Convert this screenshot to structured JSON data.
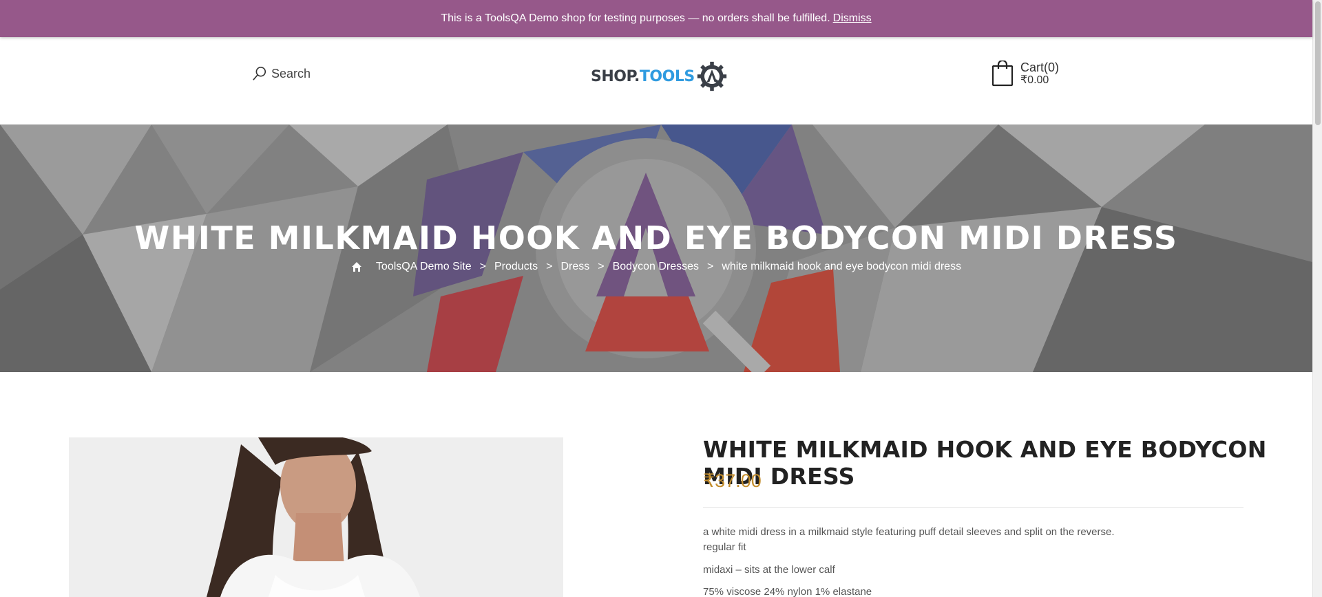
{
  "banner": {
    "message": "This is a ToolsQA Demo shop for testing purposes — no orders shall be fulfilled.",
    "dismiss_label": "Dismiss"
  },
  "header": {
    "search_label": "Search",
    "logo": {
      "shop": "SHOP",
      "dot": ".",
      "tools": "TOOLS"
    },
    "cart_label": "Cart(0)",
    "cart_amount": "₹0.00"
  },
  "hero": {
    "title": "WHITE MILKMAID HOOK AND EYE BODYCON MIDI DRESS",
    "breadcrumb": [
      "ToolsQA Demo Site",
      "Products",
      "Dress",
      "Bodycon Dresses",
      "white milkmaid hook and eye bodycon midi dress"
    ],
    "separator": ">"
  },
  "product": {
    "title": "WHITE MILKMAID HOOK AND EYE BODYCON MIDI DRESS",
    "price": "₹37.00",
    "description_lines": [
      "a white midi dress in a milkmaid style featuring puff detail sleeves and split on the reverse.",
      "regular fit",
      "midaxi – sits at the lower calf",
      "75% viscose 24% nylon 1% elastane"
    ]
  },
  "colors": {
    "banner": "#96588a",
    "price": "#c48e2d",
    "logo_blue": "#2f9be0"
  },
  "icons": [
    "search-icon",
    "cart-bag-icon",
    "home-icon",
    "logo-gear-icon"
  ]
}
